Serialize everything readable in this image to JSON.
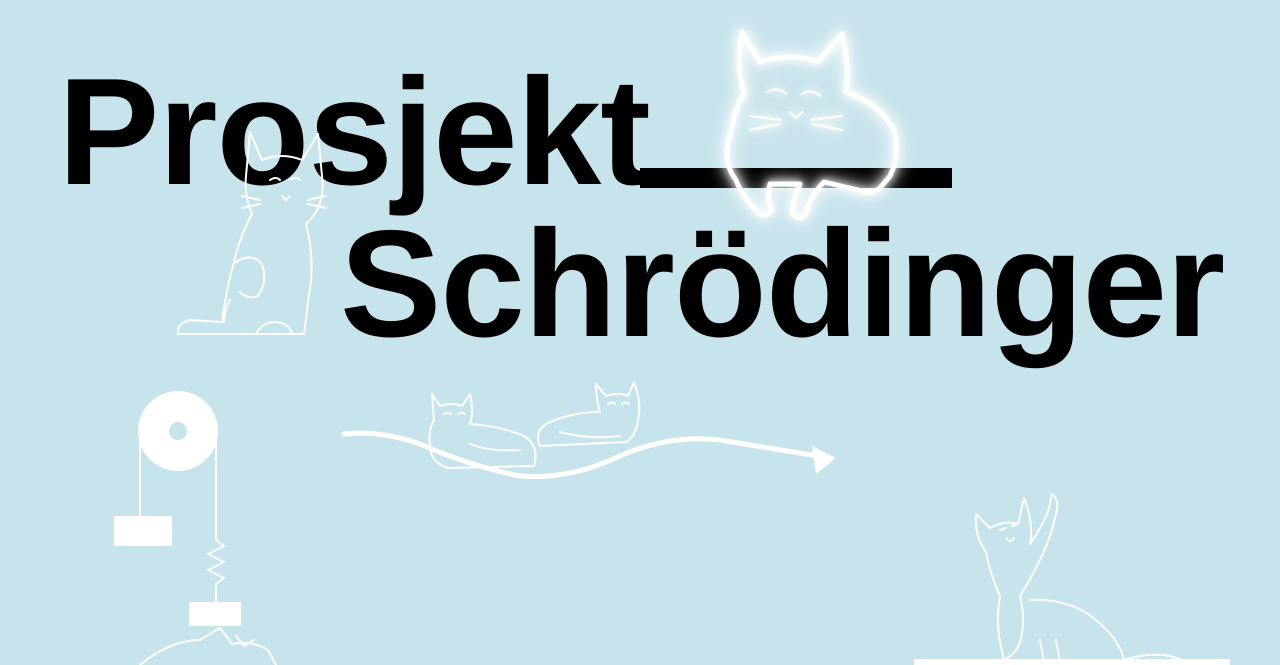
{
  "title": {
    "line1": "Prosjekt",
    "line2": "Schrödinger"
  },
  "colors": {
    "background": "#c7e3ec",
    "text": "#000000",
    "illustration": "#ffffff"
  },
  "illustrations": [
    "sitting-cat-icon",
    "glowing-cat-on-bar-icon",
    "cats-on-wave-icon",
    "pulley-spring-icon",
    "reaching-cat-icon"
  ]
}
